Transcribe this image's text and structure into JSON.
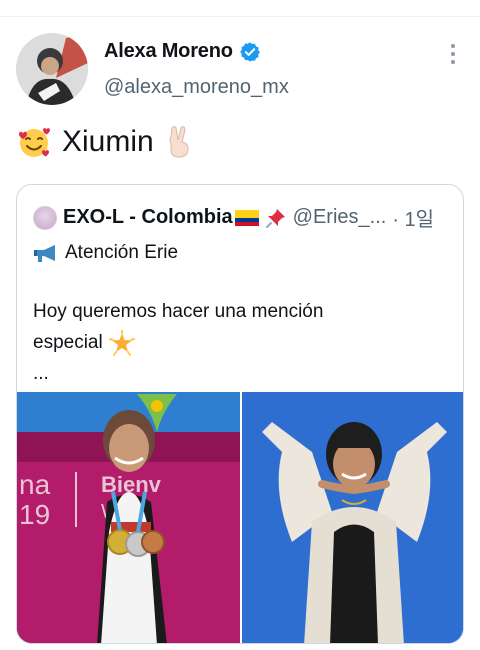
{
  "tweet": {
    "display_name": "Alexa Moreno",
    "handle": "@alexa_moreno_mx",
    "text_word": "Xiumin",
    "emoji_leading": "smiling-face-with-hearts",
    "emoji_trailing": "victory-hand"
  },
  "quote": {
    "display_name": "EXO-L - Colombia",
    "handle_truncated": "@Eries_...",
    "time": "· 1일",
    "line1": "Atención Erie",
    "line2": "Hoy queremos hacer una mención",
    "line3": "especial",
    "line4": "...",
    "media_left_sign_top": "Bienv",
    "media_left_sign_bottom": "W",
    "media_left_numbers_top": "na",
    "media_left_numbers_bottom": "19"
  },
  "colors": {
    "verified": "#1d9bf0",
    "secondary_text": "#536471",
    "border": "#cfd9de"
  }
}
